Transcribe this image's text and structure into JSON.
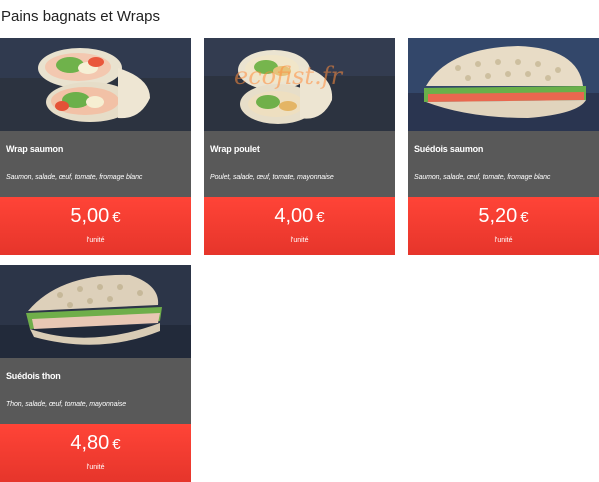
{
  "section": {
    "title": "Pains bagnats et Wraps"
  },
  "products": [
    {
      "name": "Wrap saumon",
      "description": "Saumon, salade, œuf, tomate, fromage blanc",
      "price": "5,00",
      "currency": "€",
      "unit": "l'unité",
      "image": "wrap-salmon-image"
    },
    {
      "name": "Wrap poulet",
      "description": "Poulet, salade, œuf, tomate, mayonnaise",
      "price": "4,00",
      "currency": "€",
      "unit": "l'unité",
      "image": "wrap-chicken-image",
      "watermark": "ecofist.fr"
    },
    {
      "name": "Suédois saumon",
      "description": "Saumon, salade, œuf, tomate, fromage blanc",
      "price": "5,20",
      "currency": "€",
      "unit": "l'unité",
      "image": "swedish-salmon-sandwich-image"
    },
    {
      "name": "Suédois thon",
      "description": "Thon, salade, œuf, tomate, mayonnaise",
      "price": "4,80",
      "currency": "€",
      "unit": "l'unité",
      "image": "swedish-tuna-sandwich-image"
    }
  ],
  "colors": {
    "card_background": "#595959",
    "price_background": "#f03c30",
    "image_background": "#2c3340"
  }
}
